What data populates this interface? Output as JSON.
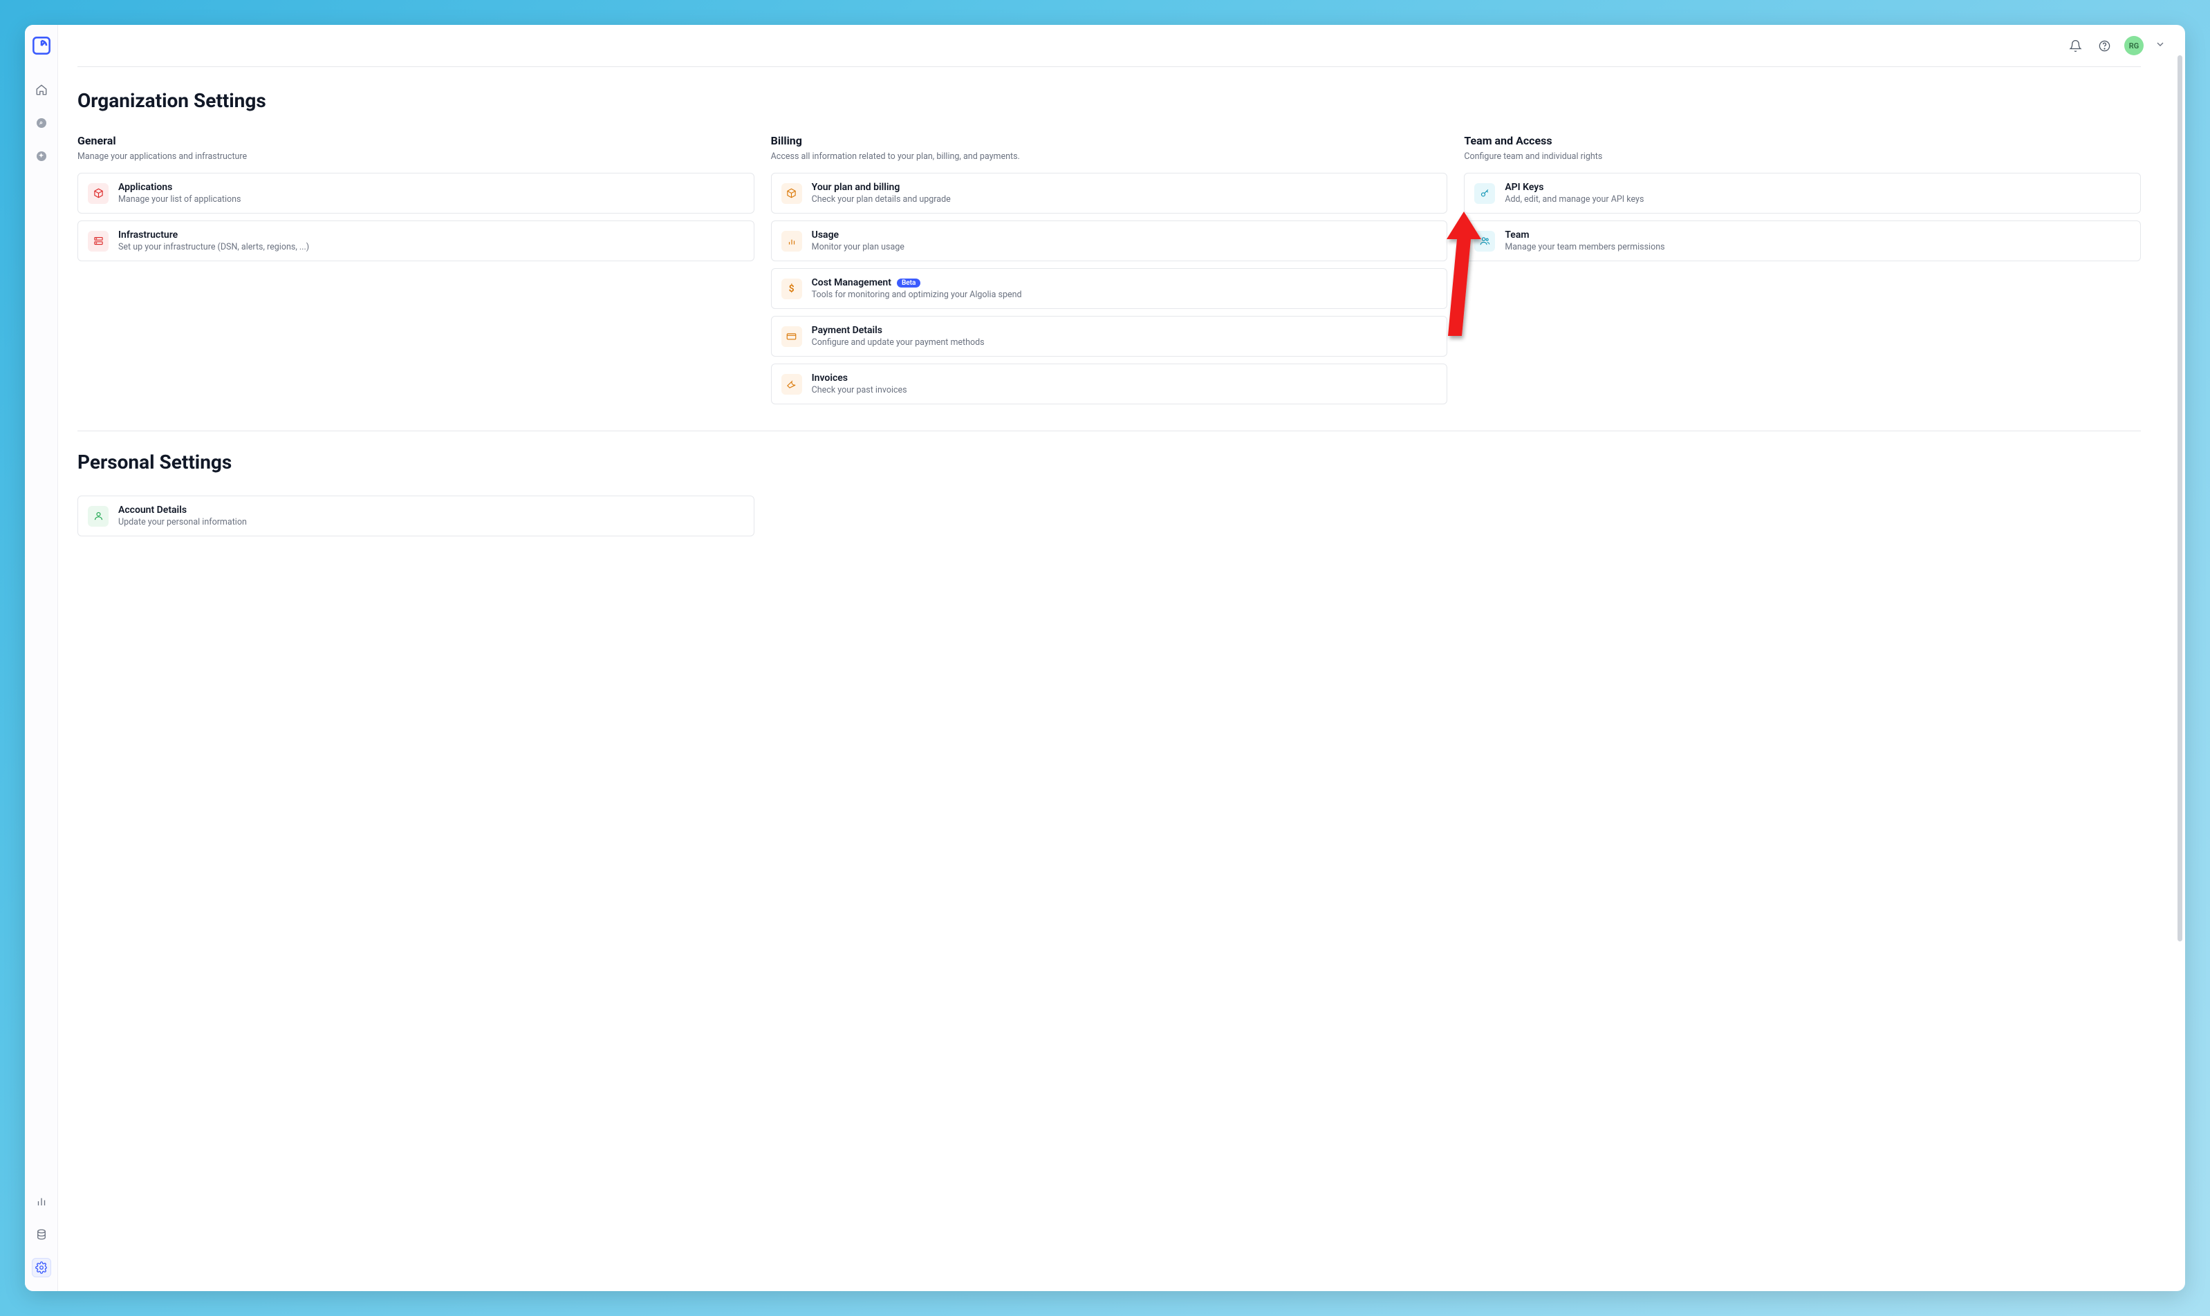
{
  "topbar": {
    "avatar_initials": "RG"
  },
  "page_title": "Organization Settings",
  "sections": {
    "general": {
      "heading": "General",
      "subtitle": "Manage your applications and infrastructure",
      "cards": [
        {
          "title": "Applications",
          "desc": "Manage your list of applications"
        },
        {
          "title": "Infrastructure",
          "desc": "Set up your infrastructure (DSN, alerts, regions, ...)"
        }
      ]
    },
    "billing": {
      "heading": "Billing",
      "subtitle": "Access all information related to your plan, billing, and payments.",
      "cards": [
        {
          "title": "Your plan and billing",
          "desc": "Check your plan details and upgrade"
        },
        {
          "title": "Usage",
          "desc": "Monitor your plan usage"
        },
        {
          "title": "Cost Management",
          "desc": "Tools for monitoring and optimizing your Algolia spend",
          "badge": "Beta"
        },
        {
          "title": "Payment Details",
          "desc": "Configure and update your payment methods"
        },
        {
          "title": "Invoices",
          "desc": "Check your past invoices"
        }
      ]
    },
    "team": {
      "heading": "Team and Access",
      "subtitle": "Configure team and individual rights",
      "cards": [
        {
          "title": "API Keys",
          "desc": "Add, edit, and manage your API keys"
        },
        {
          "title": "Team",
          "desc": "Manage your team members permissions"
        }
      ]
    }
  },
  "personal": {
    "title": "Personal Settings",
    "cards": [
      {
        "title": "Account Details",
        "desc": "Update your personal information"
      }
    ]
  }
}
